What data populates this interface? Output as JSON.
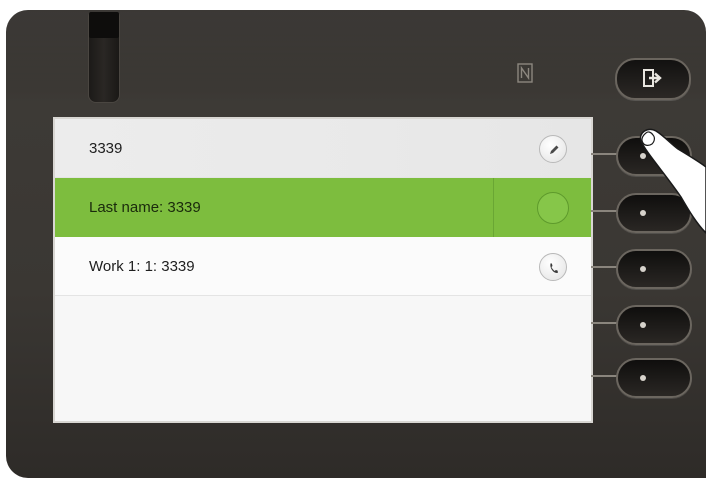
{
  "header": {
    "nfc_icon": "nfc-icon",
    "logout_icon": "logout-icon"
  },
  "list": {
    "rows": [
      {
        "label": "3339",
        "action_icon": "edit-pencil-icon"
      },
      {
        "label": "Last name: 3339",
        "action_icon": "blank-circle",
        "selected": true
      },
      {
        "label": "Work 1: 1: 3339",
        "action_icon": "phone-handset-icon"
      }
    ]
  },
  "softkeys": {
    "count": 5
  },
  "colors": {
    "selected_row": "#7dbd3e",
    "phone_body": "#3a3733",
    "screen_bg": "#f7f7f7"
  }
}
